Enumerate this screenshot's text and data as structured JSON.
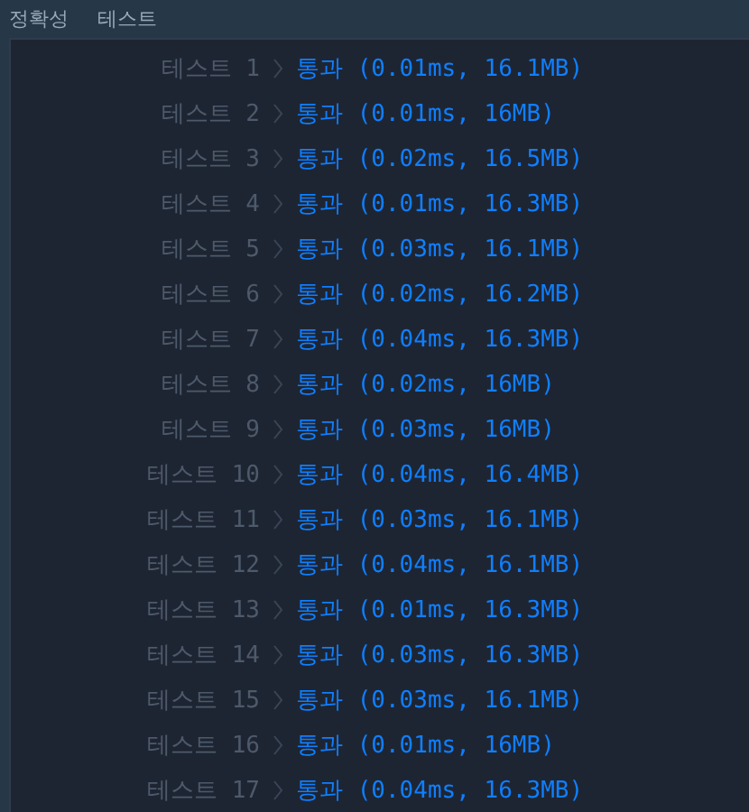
{
  "header": {
    "tabs": [
      {
        "label": "정확성"
      },
      {
        "label": "테스트"
      }
    ]
  },
  "tests": [
    {
      "label": "테스트 1",
      "result": "통과 (0.01ms, 16.1MB)"
    },
    {
      "label": "테스트 2",
      "result": "통과 (0.01ms, 16MB)"
    },
    {
      "label": "테스트 3",
      "result": "통과 (0.02ms, 16.5MB)"
    },
    {
      "label": "테스트 4",
      "result": "통과 (0.01ms, 16.3MB)"
    },
    {
      "label": "테스트 5",
      "result": "통과 (0.03ms, 16.1MB)"
    },
    {
      "label": "테스트 6",
      "result": "통과 (0.02ms, 16.2MB)"
    },
    {
      "label": "테스트 7",
      "result": "통과 (0.04ms, 16.3MB)"
    },
    {
      "label": "테스트 8",
      "result": "통과 (0.02ms, 16MB)"
    },
    {
      "label": "테스트 9",
      "result": "통과 (0.03ms, 16MB)"
    },
    {
      "label": "테스트 10",
      "result": "통과 (0.04ms, 16.4MB)"
    },
    {
      "label": "테스트 11",
      "result": "통과 (0.03ms, 16.1MB)"
    },
    {
      "label": "테스트 12",
      "result": "통과 (0.04ms, 16.1MB)"
    },
    {
      "label": "테스트 13",
      "result": "통과 (0.01ms, 16.3MB)"
    },
    {
      "label": "테스트 14",
      "result": "통과 (0.03ms, 16.3MB)"
    },
    {
      "label": "테스트 15",
      "result": "통과 (0.03ms, 16.1MB)"
    },
    {
      "label": "테스트 16",
      "result": "통과 (0.01ms, 16MB)"
    },
    {
      "label": "테스트 17",
      "result": "통과 (0.04ms, 16.3MB)"
    }
  ]
}
